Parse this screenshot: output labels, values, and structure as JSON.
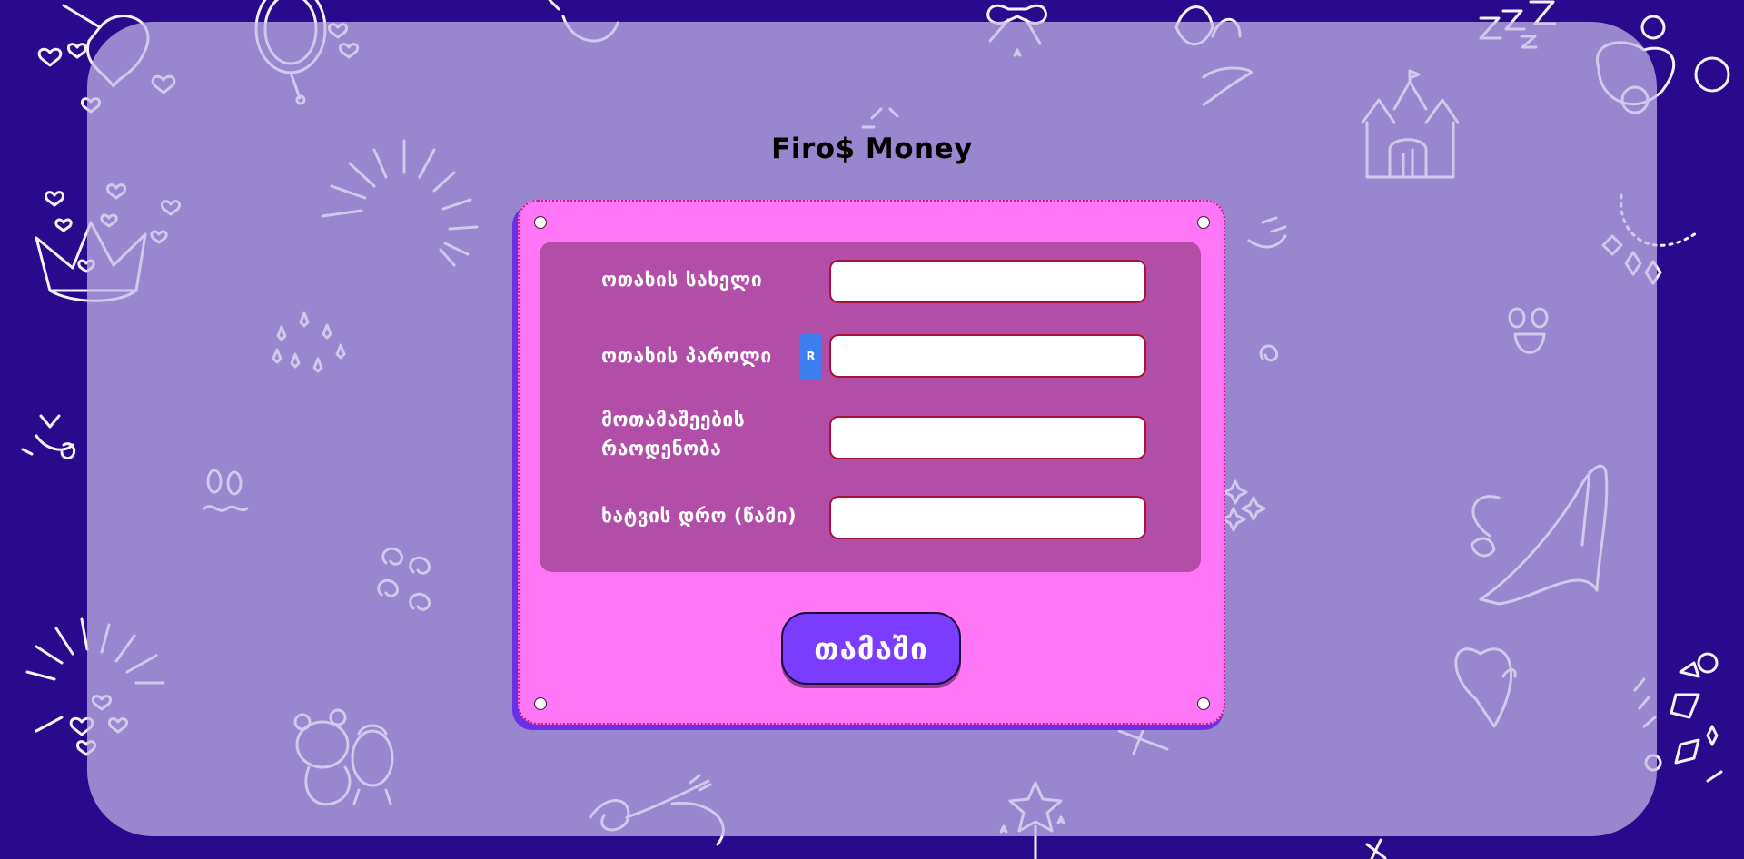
{
  "app": {
    "title": "Firo$ Money"
  },
  "form": {
    "fields": [
      {
        "label": "ოთახის სახელი",
        "value": "",
        "placeholder": ""
      },
      {
        "label": "ოთახის პაროლი",
        "value": "",
        "placeholder": ""
      },
      {
        "label": "მოთამაშეების რაოდენობა",
        "value": "",
        "placeholder": ""
      },
      {
        "label": "ხატვის დრო (წამი)",
        "value": "",
        "placeholder": ""
      }
    ],
    "random_button_label": "R",
    "play_button_label": "თამაში"
  },
  "colors": {
    "page_background": "#2a0a8c",
    "panel_background": "#c4b8e8",
    "card_background": "#ff76f6",
    "form_area_background": "#b24ea8",
    "input_border": "#a8123a",
    "random_button": "#3d7ff0",
    "play_button": "#7a3cff"
  },
  "icons": {
    "background_doodles": [
      "heart-icon",
      "crown-icon",
      "castle-icon",
      "high-heel-icon",
      "star-wand-icon",
      "sun-burst-icon",
      "bow-icon",
      "teddy-bear-icon",
      "mirror-icon",
      "necklace-icon",
      "face-icon",
      "sleep-zzz-icon",
      "sparkle-icon",
      "swirl-icon"
    ]
  }
}
